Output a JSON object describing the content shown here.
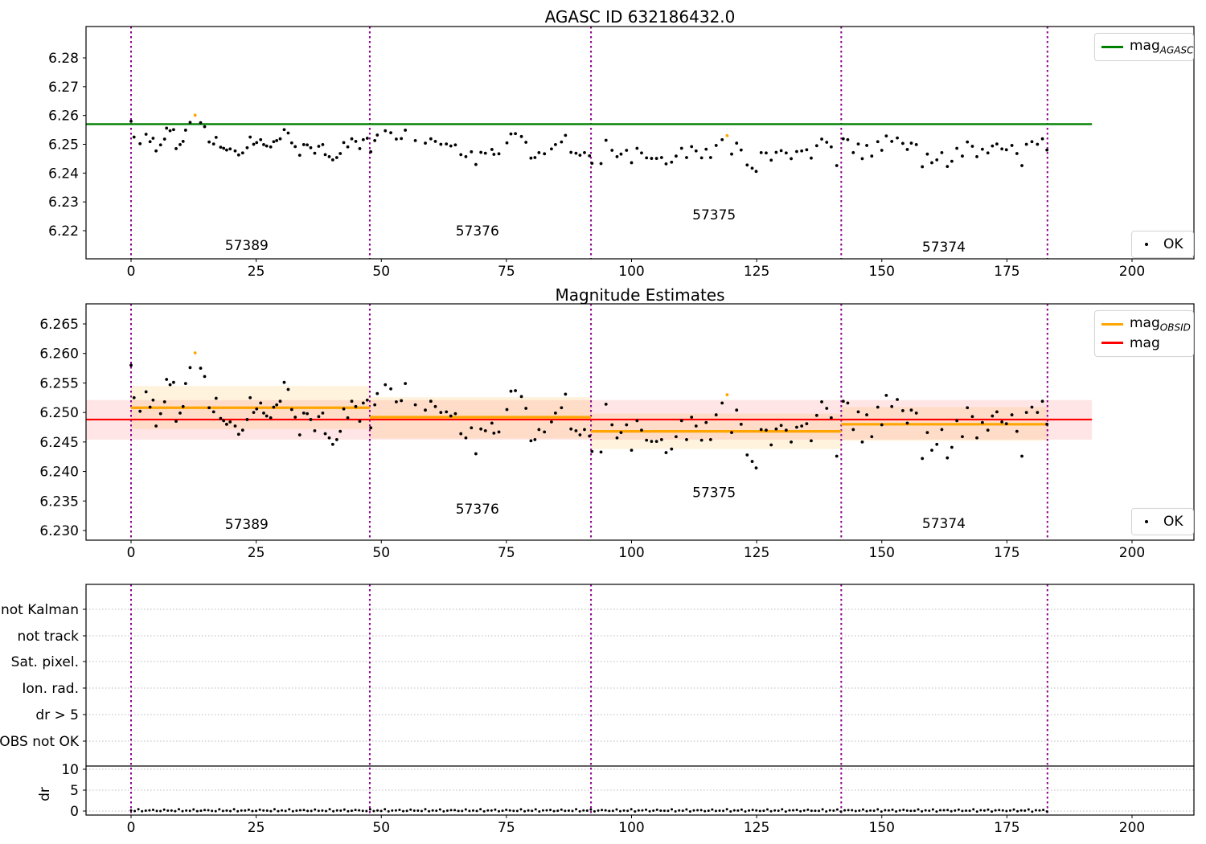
{
  "ui": {
    "top_title": "AGASC ID 632186432.0",
    "middle_title": "Magnitude Estimates",
    "legend_agasc_main": "mag",
    "legend_agasc_sub": "AGASC",
    "legend_obsid_main": "mag",
    "legend_obsid_sub": "OBSID",
    "legend_mag_label": "mag",
    "legend_ok_top": "OK",
    "legend_ok_middle": "OK"
  },
  "colors": {
    "agasc_line": "#008000",
    "obsid_line": "#ffa500",
    "mag_line": "#ff0000",
    "obsid_boundary": "#8b008b",
    "point": "#000000",
    "flagged_point": "#ffa500",
    "grid": "#bbbbbb",
    "band_red": "rgba(255,0,0,0.10)",
    "band_orange": "rgba(255,165,0,0.13)"
  },
  "chart_data": [
    {
      "id": "top",
      "type": "scatter",
      "title": "AGASC ID 632186432.0",
      "xlim": [
        -9.0,
        212.4
      ],
      "ylim": [
        6.2102,
        6.2909
      ],
      "xticks": [
        0,
        25,
        50,
        75,
        100,
        125,
        150,
        175,
        200
      ],
      "yticks": [
        6.22,
        6.23,
        6.24,
        6.25,
        6.26,
        6.27,
        6.28
      ],
      "ytick_labels": [
        "6.22",
        "6.23",
        "6.24",
        "6.25",
        "6.26",
        "6.27",
        "6.28"
      ],
      "agasc_mag": 6.257,
      "agasc_line_xend": 192,
      "legend": [
        "mag_AGASC",
        "OK"
      ],
      "obsid_boundaries": [
        0,
        47.7,
        91.9,
        141.9,
        183.1
      ],
      "obsid_labels": [
        {
          "text": "57389",
          "x": 23.1,
          "y": 6.215
        },
        {
          "text": "57376",
          "x": 69.2,
          "y": 6.22
        },
        {
          "text": "57375",
          "x": 116.5,
          "y": 6.2256
        },
        {
          "text": "57374",
          "x": 162.4,
          "y": 6.2144
        }
      ]
    },
    {
      "id": "middle",
      "type": "scatter",
      "title": "Magnitude Estimates",
      "xlim": [
        -9.0,
        212.4
      ],
      "ylim": [
        6.2284,
        6.2684
      ],
      "xticks": [
        0,
        25,
        50,
        75,
        100,
        125,
        150,
        175,
        200
      ],
      "yticks": [
        6.23,
        6.235,
        6.24,
        6.245,
        6.25,
        6.255,
        6.26,
        6.265
      ],
      "ytick_labels": [
        "6.230",
        "6.235",
        "6.240",
        "6.245",
        "6.250",
        "6.255",
        "6.260",
        "6.265"
      ],
      "mag": 6.2488,
      "mag_band": [
        6.2454,
        6.2521
      ],
      "mag_line_xend": 192,
      "legend": [
        "mag_OBSID",
        "mag",
        "OK"
      ],
      "obsid_boundaries": [
        0,
        47.7,
        91.9,
        141.9,
        183.1
      ],
      "segments": [
        {
          "obsid": "57389",
          "x0": 0.0,
          "x1": 47.7,
          "mag": 6.2508,
          "band": [
            6.2472,
            6.2545
          ]
        },
        {
          "obsid": "57376",
          "x0": 47.7,
          "x1": 91.9,
          "mag": 6.2492,
          "band": [
            6.2456,
            6.2526
          ]
        },
        {
          "obsid": "57375",
          "x0": 91.9,
          "x1": 141.9,
          "mag": 6.2468,
          "band": [
            6.2438,
            6.2498
          ]
        },
        {
          "obsid": "57374",
          "x0": 141.9,
          "x1": 183.1,
          "mag": 6.248,
          "band": [
            6.2452,
            6.2509
          ]
        }
      ],
      "obsid_labels": [
        {
          "text": "57389",
          "x": 23.1,
          "y": 6.2311
        },
        {
          "text": "57376",
          "x": 69.2,
          "y": 6.2337
        },
        {
          "text": "57375",
          "x": 116.5,
          "y": 6.2365
        },
        {
          "text": "57374",
          "x": 162.4,
          "y": 6.2312
        }
      ]
    },
    {
      "id": "bottom",
      "type": "flags",
      "categories": [
        "not Kalman",
        "not track",
        "Sat. pixel.",
        "Ion. rad.",
        "dr > 5",
        "OBS not OK"
      ],
      "flagged_samples": [],
      "dr_axis": {
        "ylabel": "dr",
        "ticks": [
          10,
          5,
          0
        ],
        "tick_labels": [
          "10",
          "5",
          "0"
        ]
      },
      "xticks": [
        0,
        25,
        50,
        75,
        100,
        125,
        150,
        175,
        200
      ],
      "obsid_boundaries": [
        0,
        47.7,
        91.9,
        141.9,
        183.1
      ],
      "dr_points": {
        "x_start": 0.0,
        "x_end": 183.0,
        "count": 250,
        "dr_level_approx": 0.3
      }
    }
  ],
  "shared_series": {
    "ok_points": [
      [
        0.0,
        6.258
      ],
      [
        0.6,
        6.2525
      ],
      [
        1.8,
        6.2502
      ],
      [
        3.0,
        6.2535
      ],
      [
        3.8,
        6.2509
      ],
      [
        4.4,
        6.2521
      ],
      [
        5.0,
        6.2477
      ],
      [
        5.9,
        6.2498
      ],
      [
        6.7,
        6.2518
      ],
      [
        7.1,
        6.2556
      ],
      [
        7.8,
        6.2547
      ],
      [
        8.5,
        6.2551
      ],
      [
        9.0,
        6.2485
      ],
      [
        9.8,
        6.2499
      ],
      [
        10.4,
        6.251
      ],
      [
        10.9,
        6.2549
      ],
      [
        11.8,
        6.2576
      ],
      [
        13.9,
        6.2575
      ],
      [
        14.7,
        6.2561
      ],
      [
        15.6,
        6.2508
      ],
      [
        16.5,
        6.2501
      ],
      [
        17.0,
        6.2524
      ],
      [
        17.9,
        6.249
      ],
      [
        18.5,
        6.2486
      ],
      [
        19.1,
        6.248
      ],
      [
        19.8,
        6.2484
      ],
      [
        20.8,
        6.2477
      ],
      [
        21.5,
        6.2463
      ],
      [
        22.3,
        6.247
      ],
      [
        23.2,
        6.2488
      ],
      [
        23.8,
        6.2525
      ],
      [
        24.5,
        6.25
      ],
      [
        25.1,
        6.2506
      ],
      [
        25.9,
        6.2516
      ],
      [
        26.5,
        6.2499
      ],
      [
        27.1,
        6.2494
      ],
      [
        27.9,
        6.2491
      ],
      [
        28.5,
        6.2509
      ],
      [
        29.1,
        6.2513
      ],
      [
        29.8,
        6.2519
      ],
      [
        30.6,
        6.2551
      ],
      [
        31.4,
        6.2539
      ],
      [
        32.1,
        6.2505
      ],
      [
        32.8,
        6.2492
      ],
      [
        33.7,
        6.2462
      ],
      [
        34.5,
        6.2499
      ],
      [
        35.2,
        6.2498
      ],
      [
        35.9,
        6.2488
      ],
      [
        36.7,
        6.2469
      ],
      [
        37.5,
        6.2493
      ],
      [
        38.3,
        6.2499
      ],
      [
        38.8,
        6.2464
      ],
      [
        39.6,
        6.2457
      ],
      [
        40.3,
        6.2446
      ],
      [
        41.1,
        6.2454
      ],
      [
        41.8,
        6.2468
      ],
      [
        42.5,
        6.2506
      ],
      [
        43.3,
        6.2491
      ],
      [
        44.1,
        6.2519
      ],
      [
        44.9,
        6.251
      ],
      [
        45.7,
        6.2485
      ],
      [
        46.4,
        6.2516
      ],
      [
        47.2,
        6.2521
      ],
      [
        47.9,
        6.2474
      ],
      [
        48.7,
        6.2513
      ],
      [
        49.2,
        6.2532
      ],
      [
        50.8,
        6.2547
      ],
      [
        51.9,
        6.254
      ],
      [
        53.0,
        6.2518
      ],
      [
        54.0,
        6.252
      ],
      [
        54.8,
        6.2549
      ],
      [
        56.8,
        6.2513
      ],
      [
        58.8,
        6.2504
      ],
      [
        59.9,
        6.2519
      ],
      [
        60.8,
        6.251
      ],
      [
        61.9,
        6.25
      ],
      [
        63.0,
        6.2501
      ],
      [
        63.9,
        6.2494
      ],
      [
        64.8,
        6.2498
      ],
      [
        65.9,
        6.2464
      ],
      [
        66.9,
        6.2457
      ],
      [
        68.0,
        6.2474
      ],
      [
        68.9,
        6.243
      ],
      [
        69.9,
        6.2472
      ],
      [
        70.8,
        6.2469
      ],
      [
        72.1,
        6.2482
      ],
      [
        72.5,
        6.2465
      ],
      [
        73.5,
        6.2467
      ],
      [
        75.1,
        6.2505
      ],
      [
        75.9,
        6.2536
      ],
      [
        76.8,
        6.2537
      ],
      [
        78.0,
        6.2527
      ],
      [
        78.9,
        6.2507
      ],
      [
        79.9,
        6.2452
      ],
      [
        80.7,
        6.2454
      ],
      [
        81.5,
        6.2471
      ],
      [
        82.6,
        6.2467
      ],
      [
        84.0,
        6.2484
      ],
      [
        84.8,
        6.2499
      ],
      [
        86.0,
        6.2508
      ],
      [
        86.8,
        6.2531
      ],
      [
        87.9,
        6.2472
      ],
      [
        88.9,
        6.2469
      ],
      [
        89.7,
        6.2462
      ],
      [
        90.6,
        6.2471
      ],
      [
        91.6,
        6.246
      ],
      [
        92.1,
        6.2434
      ],
      [
        93.9,
        6.2433
      ],
      [
        94.9,
        6.2514
      ],
      [
        96.1,
        6.2479
      ],
      [
        97.1,
        6.2457
      ],
      [
        97.9,
        6.2466
      ],
      [
        99.0,
        6.2479
      ],
      [
        100.0,
        6.2436
      ],
      [
        101.1,
        6.2486
      ],
      [
        102.0,
        6.247
      ],
      [
        103.0,
        6.2453
      ],
      [
        104.0,
        6.2451
      ],
      [
        105.0,
        6.2451
      ],
      [
        106.0,
        6.2454
      ],
      [
        106.9,
        6.2432
      ],
      [
        108.0,
        6.2438
      ],
      [
        108.9,
        6.2459
      ],
      [
        110.0,
        6.2486
      ],
      [
        111.0,
        6.2454
      ],
      [
        112.0,
        6.2492
      ],
      [
        112.9,
        6.2477
      ],
      [
        114.0,
        6.2453
      ],
      [
        114.9,
        6.2483
      ],
      [
        115.8,
        6.2454
      ],
      [
        116.9,
        6.2496
      ],
      [
        118.1,
        6.2516
      ],
      [
        120.0,
        6.2466
      ],
      [
        121.0,
        6.2504
      ],
      [
        121.9,
        6.248
      ],
      [
        123.1,
        6.2428
      ],
      [
        124.1,
        6.2417
      ],
      [
        124.9,
        6.2406
      ],
      [
        125.9,
        6.2471
      ],
      [
        126.9,
        6.247
      ],
      [
        127.9,
        6.2445
      ],
      [
        128.9,
        6.2472
      ],
      [
        129.9,
        6.2478
      ],
      [
        130.9,
        6.247
      ],
      [
        131.9,
        6.245
      ],
      [
        133.0,
        6.2475
      ],
      [
        134.0,
        6.2477
      ],
      [
        135.0,
        6.2481
      ],
      [
        135.9,
        6.2452
      ],
      [
        137.0,
        6.2495
      ],
      [
        138.0,
        6.2518
      ],
      [
        139.0,
        6.2507
      ],
      [
        139.9,
        6.2491
      ],
      [
        141.0,
        6.2426
      ],
      [
        142.3,
        6.2519
      ],
      [
        143.2,
        6.2516
      ],
      [
        144.3,
        6.2471
      ],
      [
        145.3,
        6.2501
      ],
      [
        146.1,
        6.245
      ],
      [
        147.0,
        6.2496
      ],
      [
        148.0,
        6.2459
      ],
      [
        149.2,
        6.2509
      ],
      [
        150.0,
        6.2479
      ],
      [
        150.9,
        6.2529
      ],
      [
        152.0,
        6.251
      ],
      [
        153.1,
        6.2522
      ],
      [
        154.2,
        6.2503
      ],
      [
        155.1,
        6.2482
      ],
      [
        155.9,
        6.2504
      ],
      [
        156.9,
        6.2499
      ],
      [
        158.1,
        6.2422
      ],
      [
        159.1,
        6.2466
      ],
      [
        160.0,
        6.2436
      ],
      [
        161.0,
        6.2446
      ],
      [
        162.0,
        6.2471
      ],
      [
        163.1,
        6.2423
      ],
      [
        164.0,
        6.2441
      ],
      [
        165.0,
        6.2486
      ],
      [
        166.1,
        6.2459
      ],
      [
        167.1,
        6.2508
      ],
      [
        168.1,
        6.2493
      ],
      [
        169.0,
        6.2457
      ],
      [
        170.1,
        6.2483
      ],
      [
        171.2,
        6.247
      ],
      [
        172.1,
        6.2494
      ],
      [
        173.0,
        6.2501
      ],
      [
        174.0,
        6.2484
      ],
      [
        174.9,
        6.2481
      ],
      [
        176.0,
        6.2496
      ],
      [
        177.0,
        6.2468
      ],
      [
        178.0,
        6.2426
      ],
      [
        178.9,
        6.25
      ],
      [
        180.0,
        6.2509
      ],
      [
        181.1,
        6.25
      ],
      [
        182.1,
        6.2519
      ],
      [
        183.0,
        6.248
      ]
    ],
    "flagged_points": [
      [
        12.8,
        6.2601
      ],
      [
        119.1,
        6.253
      ]
    ]
  }
}
